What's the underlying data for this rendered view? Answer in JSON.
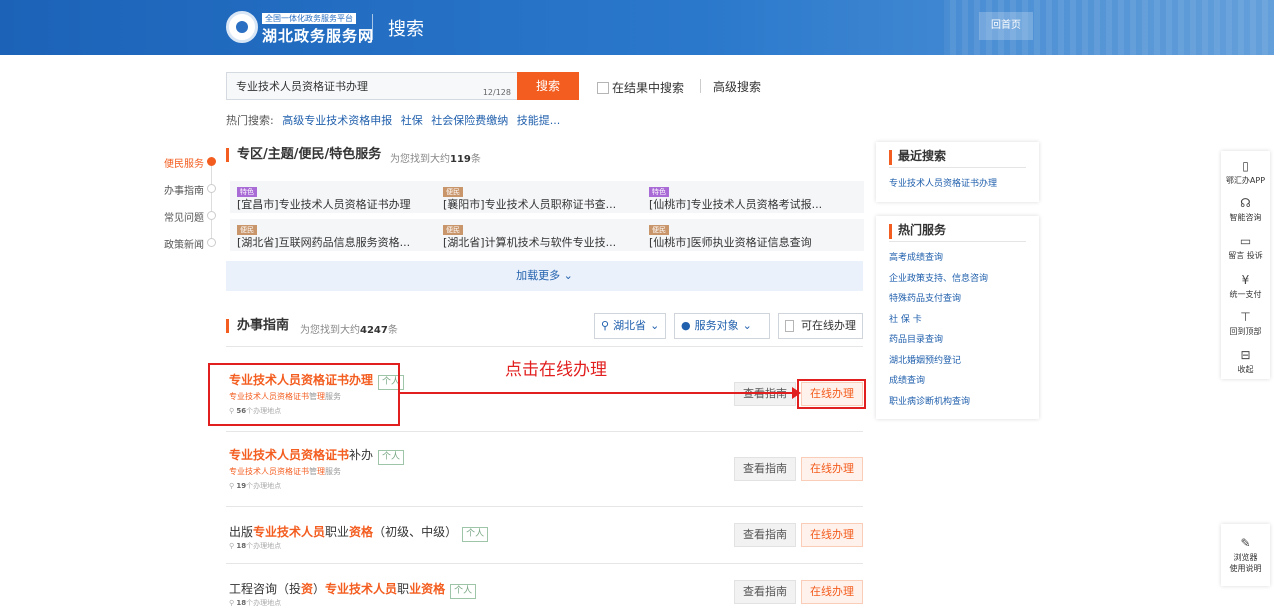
{
  "header": {
    "site_sub": "全国一体化政务服务平台",
    "site_name": "湖北政务服务网",
    "page_title": "搜索",
    "home_label": "回首页"
  },
  "search": {
    "query": "专业技术人员资格证书办理",
    "count": "12/128",
    "button_label": "搜索",
    "in_result_label": "在结果中搜索",
    "advanced_label": "高级搜索"
  },
  "hot": {
    "label": "热门搜索:",
    "keywords": [
      "高级专业技术资格申报",
      "社保",
      "社会保险费缴纳",
      "技能提..."
    ]
  },
  "side_nav": {
    "items": [
      "便民服务",
      "办事指南",
      "常见问题",
      "政策新闻"
    ]
  },
  "zone": {
    "title": "专区/主题/便民/特色服务",
    "sub_prefix": "为您找到大约",
    "count": "119",
    "sub_suffix": "条",
    "cards": [
      {
        "tag": "特色",
        "text": "[宜昌市]专业技术人员资格证书办理"
      },
      {
        "tag": "便民",
        "text": "[襄阳市]专业技术人员职称证书查..."
      },
      {
        "tag": "特色",
        "text": "[仙桃市]专业技术人员资格考试报..."
      },
      {
        "tag": "便民",
        "text": "[湖北省]互联网药品信息服务资格..."
      },
      {
        "tag": "便民",
        "text": "[湖北省]计算机技术与软件专业技..."
      },
      {
        "tag": "便民",
        "text": "[仙桃市]医师执业资格证信息查询"
      }
    ],
    "load_more": "加载更多 ⌄"
  },
  "guide": {
    "title": "办事指南",
    "sub_prefix": "为您找到大约",
    "count": "4247",
    "sub_suffix": "条",
    "filters": {
      "region": "湖北省",
      "audience": "服务对象",
      "online_only": "可在线办理"
    },
    "guide_btn": "查看指南",
    "online_btn": "在线办理",
    "items": [
      {
        "title_hl": "专业技术人员资格证书办理",
        "title_tail": "",
        "pill": "个人",
        "sub_hl": "专业技术人员资格证书",
        "sub_mid": "管",
        "sub_hl2": "理",
        "sub_tail": "服务",
        "loc_num": "56",
        "loc_text": "个办理地点"
      },
      {
        "title_hl": "专业技术人员资格证书",
        "title_tail": "补办",
        "pill": "个人",
        "sub_hl": "专业技术人员资格证书",
        "sub_mid": "管",
        "sub_hl2": "理",
        "sub_tail": "服务",
        "loc_num": "19",
        "loc_text": "个办理地点"
      },
      {
        "title_pre": "出版",
        "title_hl": "专业技术人员",
        "title_mid": "职业",
        "title_hl2": "资格",
        "title_tail": "（初级、中级）",
        "pill": "个人",
        "loc_num": "18",
        "loc_text": "个办理地点"
      },
      {
        "title_pre": "工程咨询（投",
        "title_hl0": "资",
        "title_mid0": "）",
        "title_hl": "专业技术人员",
        "title_mid": "职",
        "title_hl2": "业资格",
        "title_tail": "",
        "pill": "个人",
        "loc_num": "18",
        "loc_text": "个办理地点"
      }
    ]
  },
  "annotation": {
    "text": "点击在线办理"
  },
  "recent": {
    "title": "最近搜索",
    "links": [
      "专业技术人员资格证书办理"
    ]
  },
  "hot_services": {
    "title": "热门服务",
    "links": [
      "高考成绩查询",
      "企业政策支持、信息咨询",
      "特殊药品支付查询",
      "社 保 卡",
      "药品目录查询",
      "湖北婚姻预约登记",
      "成绩查询",
      "职业病诊断机构查询"
    ]
  },
  "float_bar": {
    "items": [
      {
        "icon": "phone-icon",
        "glyph": "▯",
        "label": "鄂汇办APP"
      },
      {
        "icon": "headset-icon",
        "glyph": "☊",
        "label": "智能咨询"
      },
      {
        "icon": "message-icon",
        "glyph": "▭",
        "label": "留言 投诉"
      },
      {
        "icon": "yuan-icon",
        "glyph": "¥",
        "label": "统一支付"
      },
      {
        "icon": "top-icon",
        "glyph": "⊤",
        "label": "回到顶部"
      },
      {
        "icon": "collapse-icon",
        "glyph": "⊟",
        "label": "收起"
      }
    ],
    "browser_label_1": "浏览器",
    "browser_label_2": "使用说明"
  },
  "colors": {
    "accent": "#f35d1f",
    "link": "#2160ad",
    "header": "#2a78cc",
    "annotation": "#e21f1f"
  }
}
